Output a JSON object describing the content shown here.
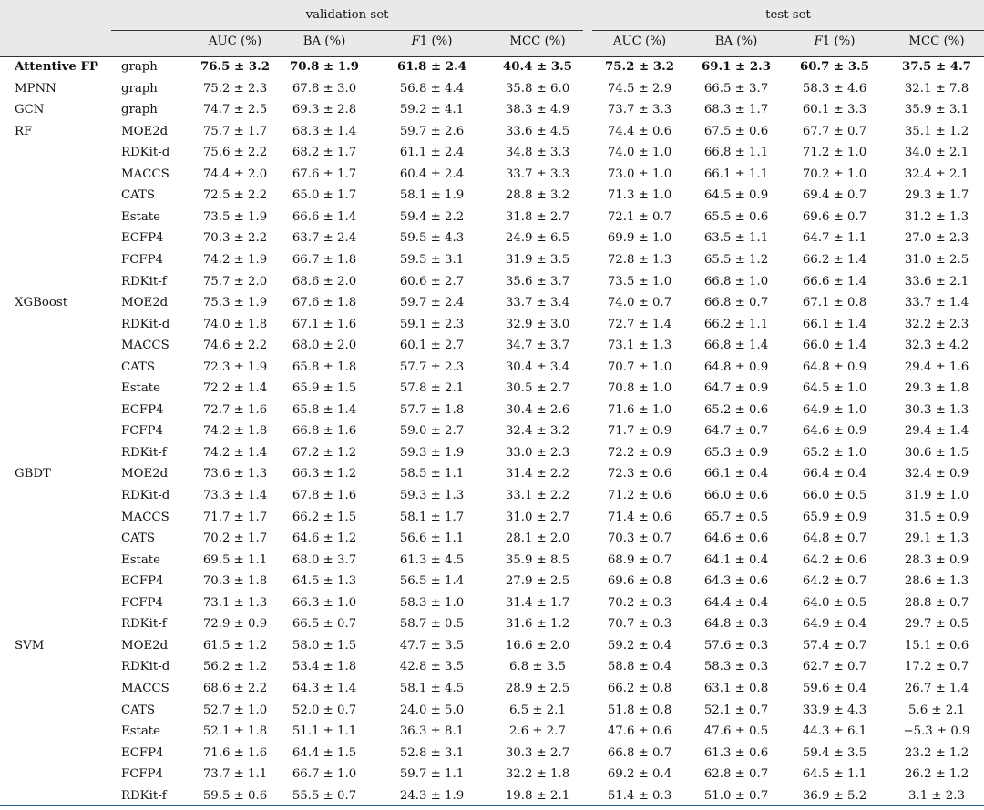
{
  "groups": [
    "validation set",
    "test set"
  ],
  "columns": [
    "AUC (%)",
    "BA (%)",
    "F1 (%)",
    "MCC (%)",
    "AUC (%)",
    "BA (%)",
    "F1 (%)",
    "MCC (%)"
  ],
  "rows": [
    {
      "model": "Attentive FP",
      "feature": "graph",
      "values": [
        "76.5 ± 3.2",
        "70.8 ± 1.9",
        "61.8 ± 2.4",
        "40.4 ± 3.5",
        "75.2 ± 3.2",
        "69.1 ± 2.3",
        "60.7 ± 3.5",
        "37.5 ± 4.7"
      ],
      "bold": true
    },
    {
      "model": "MPNN",
      "feature": "graph",
      "values": [
        "75.2 ± 2.3",
        "67.8 ± 3.0",
        "56.8 ± 4.4",
        "35.8 ± 6.0",
        "74.5 ± 2.9",
        "66.5 ± 3.7",
        "58.3 ± 4.6",
        "32.1 ± 7.8"
      ]
    },
    {
      "model": "GCN",
      "feature": "graph",
      "values": [
        "74.7 ± 2.5",
        "69.3 ± 2.8",
        "59.2 ± 4.1",
        "38.3 ± 4.9",
        "73.7 ± 3.3",
        "68.3 ± 1.7",
        "60.1 ± 3.3",
        "35.9 ± 3.1"
      ]
    },
    {
      "model": "RF",
      "feature": "MOE2d",
      "values": [
        "75.7 ± 1.7",
        "68.3 ± 1.4",
        "59.7 ± 2.6",
        "33.6 ± 4.5",
        "74.4 ± 0.6",
        "67.5 ± 0.6",
        "67.7 ± 0.7",
        "35.1 ± 1.2"
      ]
    },
    {
      "model": "",
      "feature": "RDKit-d",
      "values": [
        "75.6 ± 2.2",
        "68.2 ± 1.7",
        "61.1 ± 2.4",
        "34.8 ± 3.3",
        "74.0 ± 1.0",
        "66.8 ± 1.1",
        "71.2 ± 1.0",
        "34.0 ± 2.1"
      ]
    },
    {
      "model": "",
      "feature": "MACCS",
      "values": [
        "74.4 ± 2.0",
        "67.6 ± 1.7",
        "60.4 ± 2.4",
        "33.7 ± 3.3",
        "73.0 ± 1.0",
        "66.1 ± 1.1",
        "70.2 ± 1.0",
        "32.4 ± 2.1"
      ]
    },
    {
      "model": "",
      "feature": "CATS",
      "values": [
        "72.5 ± 2.2",
        "65.0 ± 1.7",
        "58.1 ± 1.9",
        "28.8 ± 3.2",
        "71.3 ± 1.0",
        "64.5 ± 0.9",
        "69.4 ± 0.7",
        "29.3 ± 1.7"
      ]
    },
    {
      "model": "",
      "feature": "Estate",
      "values": [
        "73.5 ± 1.9",
        "66.6 ± 1.4",
        "59.4 ± 2.2",
        "31.8 ± 2.7",
        "72.1 ± 0.7",
        "65.5 ± 0.6",
        "69.6 ± 0.7",
        "31.2 ± 1.3"
      ]
    },
    {
      "model": "",
      "feature": "ECFP4",
      "values": [
        "70.3 ± 2.2",
        "63.7 ± 2.4",
        "59.5 ± 4.3",
        "24.9 ± 6.5",
        "69.9 ± 1.0",
        "63.5 ± 1.1",
        "64.7 ± 1.1",
        "27.0 ± 2.3"
      ]
    },
    {
      "model": "",
      "feature": "FCFP4",
      "values": [
        "74.2 ± 1.9",
        "66.7 ± 1.8",
        "59.5 ± 3.1",
        "31.9 ± 3.5",
        "72.8 ± 1.3",
        "65.5 ± 1.2",
        "66.2 ± 1.4",
        "31.0 ± 2.5"
      ]
    },
    {
      "model": "",
      "feature": "RDKit-f",
      "values": [
        "75.7 ± 2.0",
        "68.6 ± 2.0",
        "60.6 ± 2.7",
        "35.6 ± 3.7",
        "73.5 ± 1.0",
        "66.8 ± 1.0",
        "66.6 ± 1.4",
        "33.6 ± 2.1"
      ]
    },
    {
      "model": "XGBoost",
      "feature": "MOE2d",
      "values": [
        "75.3 ± 1.9",
        "67.6 ± 1.8",
        "59.7 ± 2.4",
        "33.7 ± 3.4",
        "74.0 ± 0.7",
        "66.8 ± 0.7",
        "67.1 ± 0.8",
        "33.7 ± 1.4"
      ]
    },
    {
      "model": "",
      "feature": "RDKit-d",
      "values": [
        "74.0 ± 1.8",
        "67.1 ± 1.6",
        "59.1 ± 2.3",
        "32.9 ± 3.0",
        "72.7 ± 1.4",
        "66.2 ± 1.1",
        "66.1 ± 1.4",
        "32.2 ± 2.3"
      ]
    },
    {
      "model": "",
      "feature": "MACCS",
      "values": [
        "74.6 ± 2.2",
        "68.0 ± 2.0",
        "60.1 ± 2.7",
        "34.7 ± 3.7",
        "73.1 ± 1.3",
        "66.8 ± 1.4",
        "66.0 ± 1.4",
        "32.3 ± 4.2"
      ]
    },
    {
      "model": "",
      "feature": "CATS",
      "values": [
        "72.3 ± 1.9",
        "65.8 ± 1.8",
        "57.7 ± 2.3",
        "30.4 ± 3.4",
        "70.7 ± 1.0",
        "64.8 ± 0.9",
        "64.8 ± 0.9",
        "29.4 ± 1.6"
      ]
    },
    {
      "model": "",
      "feature": "Estate",
      "values": [
        "72.2 ± 1.4",
        "65.9 ± 1.5",
        "57.8 ± 2.1",
        "30.5 ± 2.7",
        "70.8 ± 1.0",
        "64.7 ± 0.9",
        "64.5 ± 1.0",
        "29.3 ± 1.8"
      ]
    },
    {
      "model": "",
      "feature": "ECFP4",
      "values": [
        "72.7 ± 1.6",
        "65.8 ± 1.4",
        "57.7 ± 1.8",
        "30.4 ± 2.6",
        "71.6 ± 1.0",
        "65.2 ± 0.6",
        "64.9 ± 1.0",
        "30.3 ± 1.3"
      ]
    },
    {
      "model": "",
      "feature": "FCFP4",
      "values": [
        "74.2 ± 1.8",
        "66.8 ± 1.6",
        "59.0 ± 2.7",
        "32.4 ± 3.2",
        "71.7 ± 0.9",
        "64.7 ± 0.7",
        "64.6 ± 0.9",
        "29.4 ± 1.4"
      ]
    },
    {
      "model": "",
      "feature": "RDKit-f",
      "values": [
        "74.2 ± 1.4",
        "67.2 ± 1.2",
        "59.3 ± 1.9",
        "33.0 ± 2.3",
        "72.2 ± 0.9",
        "65.3 ± 0.9",
        "65.2 ± 1.0",
        "30.6 ± 1.5"
      ]
    },
    {
      "model": "GBDT",
      "feature": "MOE2d",
      "values": [
        "73.6 ± 1.3",
        "66.3 ± 1.2",
        "58.5 ± 1.1",
        "31.4 ± 2.2",
        "72.3 ± 0.6",
        "66.1 ± 0.4",
        "66.4 ± 0.4",
        "32.4 ± 0.9"
      ]
    },
    {
      "model": "",
      "feature": "RDKit-d",
      "values": [
        "73.3 ± 1.4",
        "67.8 ± 1.6",
        "59.3 ± 1.3",
        "33.1 ± 2.2",
        "71.2 ± 0.6",
        "66.0 ± 0.6",
        "66.0 ± 0.5",
        "31.9 ± 1.0"
      ]
    },
    {
      "model": "",
      "feature": "MACCS",
      "values": [
        "71.7 ± 1.7",
        "66.2 ± 1.5",
        "58.1 ± 1.7",
        "31.0 ± 2.7",
        "71.4 ± 0.6",
        "65.7 ± 0.5",
        "65.9 ± 0.9",
        "31.5 ± 0.9"
      ]
    },
    {
      "model": "",
      "feature": "CATS",
      "values": [
        "70.2 ± 1.7",
        "64.6 ± 1.2",
        "56.6 ± 1.1",
        "28.1 ± 2.0",
        "70.3 ± 0.7",
        "64.6 ± 0.6",
        "64.8 ± 0.7",
        "29.1 ± 1.3"
      ]
    },
    {
      "model": "",
      "feature": "Estate",
      "values": [
        "69.5 ± 1.1",
        "68.0 ± 3.7",
        "61.3 ± 4.5",
        "35.9 ± 8.5",
        "68.9 ± 0.7",
        "64.1 ± 0.4",
        "64.2 ± 0.6",
        "28.3 ± 0.9"
      ]
    },
    {
      "model": "",
      "feature": "ECFP4",
      "values": [
        "70.3 ± 1.8",
        "64.5 ± 1.3",
        "56.5 ± 1.4",
        "27.9 ± 2.5",
        "69.6 ± 0.8",
        "64.3 ± 0.6",
        "64.2 ± 0.7",
        "28.6 ± 1.3"
      ]
    },
    {
      "model": "",
      "feature": "FCFP4",
      "values": [
        "73.1 ± 1.3",
        "66.3 ± 1.0",
        "58.3 ± 1.0",
        "31.4 ± 1.7",
        "70.2 ± 0.3",
        "64.4 ± 0.4",
        "64.0 ± 0.5",
        "28.8 ± 0.7"
      ]
    },
    {
      "model": "",
      "feature": "RDKit-f",
      "values": [
        "72.9 ± 0.9",
        "66.5 ± 0.7",
        "58.7 ± 0.5",
        "31.6 ± 1.2",
        "70.7 ± 0.3",
        "64.8 ± 0.3",
        "64.9 ± 0.4",
        "29.7 ± 0.5"
      ]
    },
    {
      "model": "SVM",
      "feature": "MOE2d",
      "values": [
        "61.5 ± 1.2",
        "58.0 ± 1.5",
        "47.7 ± 3.5",
        "16.6 ± 2.0",
        "59.2 ± 0.4",
        "57.6 ± 0.3",
        "57.4 ± 0.7",
        "15.1 ± 0.6"
      ]
    },
    {
      "model": "",
      "feature": "RDKit-d",
      "values": [
        "56.2 ± 1.2",
        "53.4 ± 1.8",
        "42.8 ± 3.5",
        "6.8 ± 3.5",
        "58.8 ± 0.4",
        "58.3 ± 0.3",
        "62.7 ± 0.7",
        "17.2 ± 0.7"
      ]
    },
    {
      "model": "",
      "feature": "MACCS",
      "values": [
        "68.6 ± 2.2",
        "64.3 ± 1.4",
        "58.1 ± 4.5",
        "28.9 ± 2.5",
        "66.2 ± 0.8",
        "63.1 ± 0.8",
        "59.6 ± 0.4",
        "26.7 ± 1.4"
      ]
    },
    {
      "model": "",
      "feature": "CATS",
      "values": [
        "52.7 ± 1.0",
        "52.0 ± 0.7",
        "24.0 ± 5.0",
        "6.5 ± 2.1",
        "51.8 ± 0.8",
        "52.1 ± 0.7",
        "33.9 ± 4.3",
        "5.6 ± 2.1"
      ]
    },
    {
      "model": "",
      "feature": "Estate",
      "values": [
        "52.1 ± 1.8",
        "51.1 ± 1.1",
        "36.3 ± 8.1",
        "2.6 ± 2.7",
        "47.6 ± 0.6",
        "47.6 ± 0.5",
        "44.3 ± 6.1",
        "−5.3 ± 0.9"
      ]
    },
    {
      "model": "",
      "feature": "ECFP4",
      "values": [
        "71.6 ± 1.6",
        "64.4 ± 1.5",
        "52.8 ± 3.1",
        "30.3 ± 2.7",
        "66.8 ± 0.7",
        "61.3 ± 0.6",
        "59.4 ± 3.5",
        "23.2 ± 1.2"
      ]
    },
    {
      "model": "",
      "feature": "FCFP4",
      "values": [
        "73.7 ± 1.1",
        "66.7 ± 1.0",
        "59.7 ± 1.1",
        "32.2 ± 1.8",
        "69.2 ± 0.4",
        "62.8 ± 0.7",
        "64.5 ± 1.1",
        "26.2 ± 1.2"
      ]
    },
    {
      "model": "",
      "feature": "RDKit-f",
      "values": [
        "59.5 ± 0.6",
        "55.5 ± 0.7",
        "24.3 ± 1.9",
        "19.8 ± 2.1",
        "51.4 ± 0.3",
        "51.0 ± 0.7",
        "36.9 ± 5.2",
        "3.1 ± 2.3"
      ]
    }
  ]
}
